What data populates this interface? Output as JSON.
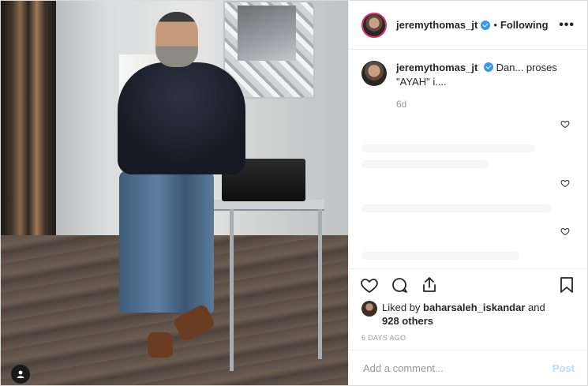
{
  "post": {
    "username": "jeremythomas_jt",
    "separator": "•",
    "follow_status": "Following",
    "more_label": "•••"
  },
  "caption": {
    "username": "jeremythomas_jt",
    "text": "Dan... proses \"AYAH\" i....",
    "time": "6d"
  },
  "likes": {
    "prefix": "Liked by",
    "user": "baharsaleh_iskandar",
    "joiner": "and",
    "count": "928 others"
  },
  "posted_date": "6 DAYS AGO",
  "comment_box": {
    "placeholder": "Add a comment...",
    "post_label": "Post"
  },
  "icons": [
    "heart-icon",
    "comment-icon",
    "share-icon",
    "bookmark-icon",
    "more-icon",
    "verified-icon",
    "user-tag-icon"
  ],
  "colors": {
    "verified": "#3897f0",
    "post_disabled": "#b2dffc",
    "muted": "#999999"
  }
}
